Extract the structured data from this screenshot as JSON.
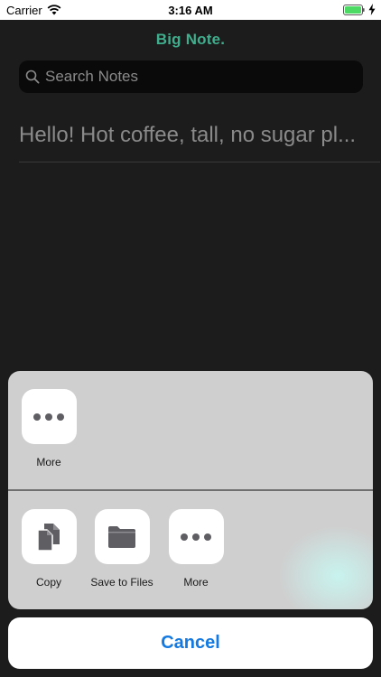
{
  "status_bar": {
    "carrier": "Carrier",
    "time": "3:16 AM",
    "battery_color": "#4cd964"
  },
  "app": {
    "title": "Big Note.",
    "title_color": "#3fae8c",
    "search": {
      "placeholder": "Search Notes",
      "value": ""
    },
    "notes": [
      {
        "text": "Hello! Hot coffee, tall, no sugar pl..."
      }
    ]
  },
  "share_sheet": {
    "app_row": [
      {
        "label": "More",
        "icon": "more-icon"
      }
    ],
    "action_row": [
      {
        "label": "Copy",
        "icon": "copy-icon"
      },
      {
        "label": "Save to Files",
        "icon": "folder-icon"
      },
      {
        "label": "More",
        "icon": "more-icon"
      }
    ],
    "cancel_label": "Cancel",
    "cancel_color": "#1479e0"
  }
}
